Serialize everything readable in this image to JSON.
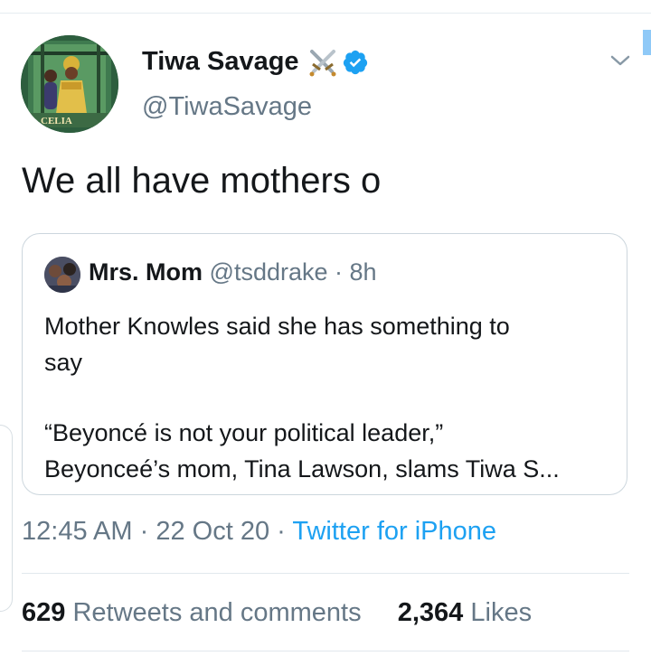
{
  "tweet": {
    "author": {
      "display_name": "Tiwa Savage",
      "handle": "@TiwaSavage",
      "avatar_caption": "CELIA",
      "name_emoji_icon": "crossed-swords-icon",
      "verified_icon": "verified-badge-icon"
    },
    "text": "We all have mothers o",
    "quoted": {
      "author_name": "Mrs. Mom",
      "author_handle": "@tsddrake",
      "separator": "·",
      "time_ago": "8h",
      "lines": [
        "Mother Knowles said she has something to",
        "say",
        "",
        "“Beyoncé is not your political leader,”",
        "Beyonceé’s mom, Tina Lawson, slams Tiwa S..."
      ]
    },
    "time": "12:45 AM",
    "sep1": "·",
    "date": "22 Oct 20",
    "sep2": "·",
    "source": "Twitter for iPhone",
    "retweets_count": "629",
    "retweets_label": "Retweets and comments",
    "likes_count": "2,364",
    "likes_label": "Likes"
  },
  "colors": {
    "link": "#1da1f2",
    "secondary_text": "#657786",
    "primary_text": "#14171a",
    "verified": "#1da1f2"
  },
  "icons": {
    "more": "chevron-down-icon"
  }
}
